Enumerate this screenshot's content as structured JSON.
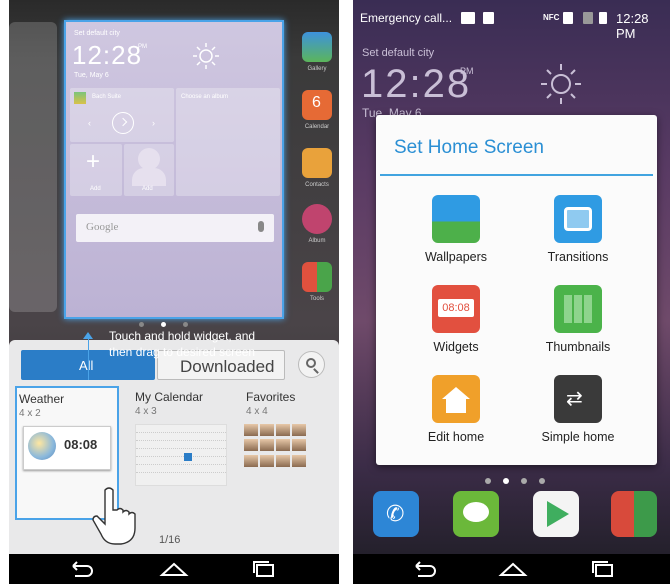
{
  "left_screen": {
    "preview": {
      "city": "Set default city",
      "time": "12:28",
      "ampm": "PM",
      "date": "Tue, May 6",
      "music_title": "Bach Suite",
      "album_label": "Choose an album",
      "add_label_1": "Add",
      "add_label_2": "Add",
      "search_brand": "Google"
    },
    "side_apps": [
      "Gallery",
      "Calendar",
      "Contacts",
      "Album",
      "Tools"
    ],
    "tip": "Touch and hold widget, and then drag to desired screen",
    "tabs": {
      "all": "All",
      "downloaded": "Downloaded"
    },
    "widgets": [
      {
        "name": "Weather",
        "size": "4 x 2",
        "time": "08:08"
      },
      {
        "name": "My Calendar",
        "size": "4 x 3"
      },
      {
        "name": "Favorites",
        "size": "4 x 4"
      }
    ],
    "pager": "1/16"
  },
  "right_screen": {
    "status": {
      "carrier": "Emergency call...",
      "nfc": "NFC",
      "clock": "12:28 PM"
    },
    "weather": {
      "city": "Set default city",
      "time": "12:28",
      "ampm": "PM",
      "date": "Tue, May 6"
    },
    "dialog": {
      "title": "Set Home Screen",
      "options": [
        {
          "label": "Wallpapers",
          "icon": "wallpapers-icon",
          "color": "#2f9be3"
        },
        {
          "label": "Transitions",
          "icon": "transitions-icon",
          "color": "#2f9be3"
        },
        {
          "label": "Widgets",
          "icon": "widgets-icon",
          "color": "#e2503f"
        },
        {
          "label": "Thumbnails",
          "icon": "thumbnails-icon",
          "color": "#4bb34a"
        },
        {
          "label": "Edit home",
          "icon": "edit-home-icon",
          "color": "#f0a02a"
        },
        {
          "label": "Simple home",
          "icon": "simple-home-icon",
          "color": "#3a3a3a"
        }
      ],
      "accent": "#2a8fd4"
    },
    "dock": [
      "phone-icon",
      "messaging-icon",
      "play-store-icon",
      "google-apps-icon"
    ]
  }
}
